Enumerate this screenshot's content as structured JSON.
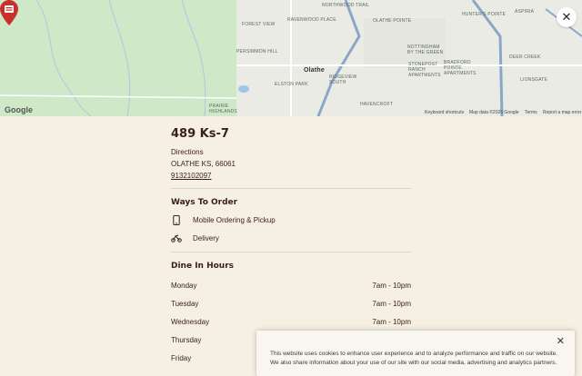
{
  "map": {
    "labels": {
      "northwood_trail": "NORTHWOOD TRAIL",
      "ravenwood_place": "RAVENWOOD PLACE",
      "forest_view": "FOREST VIEW",
      "olathe_pointe": "OLATHE POINTE",
      "hunters_pointe": "HUNTER'S POINTE",
      "aspiria": "ASPIRIA",
      "persimmon_hill": "PERSIMMON HILL",
      "nottingham": "NOTTINGHAM BY THE GREEN",
      "deer_creek": "DEER CREEK",
      "olathe": "Olathe",
      "stonepost": "STONEPOST RANCH APARTMENTS",
      "bradford": "BRADFORD POINTE APARTMENTS",
      "ridgeview": "RIDGEVIEW SOUTH",
      "elston_park": "ELSTON PARK",
      "lionsgate": "LIONSGATE",
      "prairie": "PRAIRIE HIGHLANDS",
      "havencroft": "HAVENCROFT"
    },
    "google": "Google",
    "keyboard_shortcuts": "Keyboard shortcuts",
    "map_data": "Map data ©2026 Google",
    "terms": "Terms",
    "report": "Report a map error",
    "close": "✕"
  },
  "store": {
    "title": "489 Ks-7",
    "directions": "Directions",
    "city": "OLATHE KS, 66061",
    "phone": "9132102097"
  },
  "ways_to_order": {
    "title": "Ways To Order",
    "items": [
      {
        "label": "Mobile Ordering & Pickup",
        "icon": "phone-icon"
      },
      {
        "label": "Delivery",
        "icon": "scooter-icon"
      }
    ]
  },
  "hours": {
    "title": "Dine In Hours",
    "rows": [
      {
        "day": "Monday",
        "time": "7am - 10pm"
      },
      {
        "day": "Tuesday",
        "time": "7am - 10pm"
      },
      {
        "day": "Wednesday",
        "time": "7am - 10pm"
      },
      {
        "day": "Thursday",
        "time": ""
      },
      {
        "day": "Friday",
        "time": ""
      }
    ]
  },
  "cookie": {
    "text": "This website uses cookies to enhance user experience and to analyze performance and traffic on our website. We also share information about your use of our site with our social media, advertising and analytics partners.",
    "close": "✕"
  }
}
